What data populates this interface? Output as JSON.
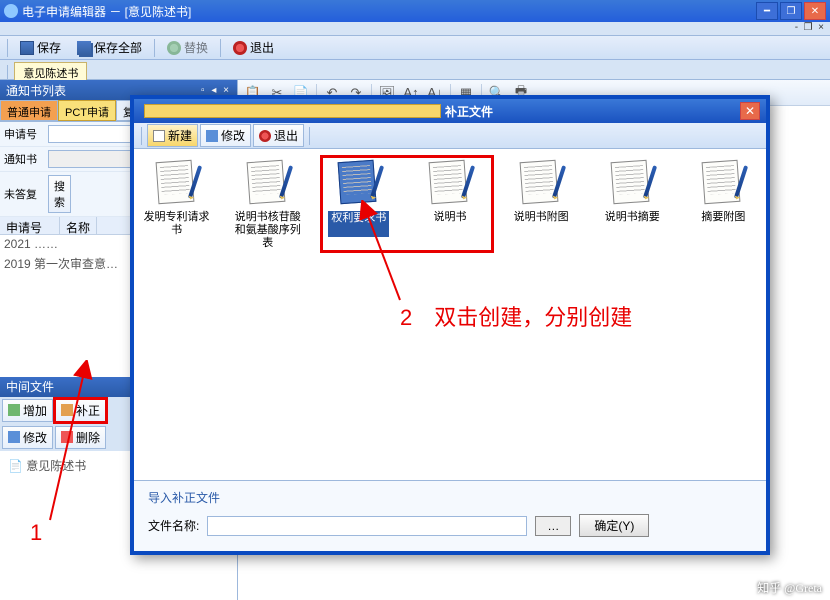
{
  "app": {
    "title": "电子申请编辑器 － [意见陈述书]"
  },
  "mainToolbar": {
    "save": "保存",
    "saveAll": "保存全部",
    "replace": "替换",
    "exit": "退出"
  },
  "docTab": "意见陈述书",
  "leftPanel": {
    "listTitle": "通知书列表",
    "tabs": {
      "normal": "普通申请",
      "pct": "PCT申请",
      "review": "复审无效"
    },
    "fields": {
      "appNo": "申请号",
      "notice": "通知书",
      "status": "未答复",
      "search": "搜索"
    },
    "cols": {
      "appNo": "申请号",
      "name": "名称"
    },
    "rows": [
      "2021  ……",
      "2019   第一次审查意…"
    ],
    "midTitle": "中间文件",
    "btns": {
      "add": "增加",
      "correct": "补正",
      "modify": "修改",
      "delete": "删除"
    },
    "treeItem": "意见陈述书"
  },
  "modal": {
    "title": "补正文件",
    "tb": {
      "new": "新建",
      "modify": "修改",
      "exit": "退出"
    },
    "items": [
      "发明专利请求书",
      "说明书核苷酸和氨基酸序列表",
      "权利要求书",
      "说明书",
      "说明书附图",
      "说明书摘要",
      "摘要附图"
    ],
    "importGroup": "导入补正文件",
    "fileLabel": "文件名称:",
    "browse": "…",
    "ok": "确定(Y)"
  },
  "annot": {
    "one": "1",
    "two": "2　双击创建，分别创建"
  },
  "watermark": "知乎 @Greta"
}
